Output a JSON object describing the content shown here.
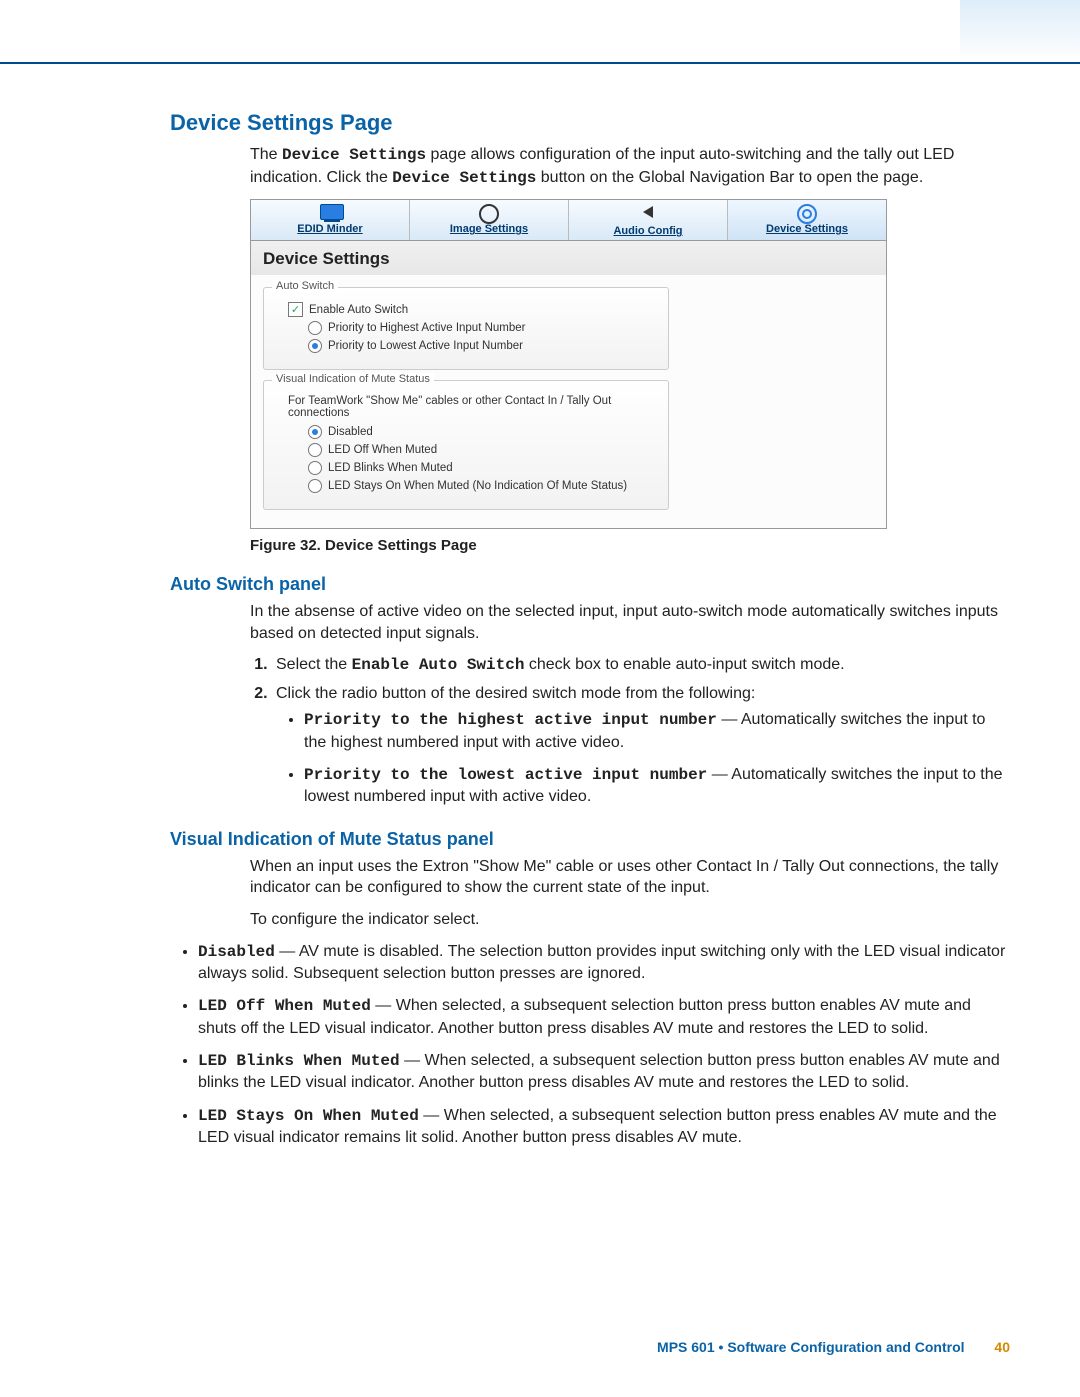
{
  "heading_main": "Device Settings Page",
  "intro_before": "The ",
  "intro_mono1": "Device Settings",
  "intro_mid": " page allows configuration of the input auto-switching and the tally out LED indication. Click the ",
  "intro_mono2": "Device Settings",
  "intro_after": " button on the Global Navigation Bar to open the page.",
  "tabs": {
    "edid": "EDID Minder",
    "image": "Image Settings",
    "audio": "Audio Config",
    "device": "Device Settings"
  },
  "panel": {
    "title": "Device Settings",
    "autoswitch_legend": "Auto Switch",
    "enable_auto": "Enable Auto Switch",
    "prio_high": "Priority to Highest Active Input Number",
    "prio_low": "Priority to Lowest Active Input Number",
    "mute_legend": "Visual Indication of Mute Status",
    "mute_note": "For TeamWork \"Show Me\" cables or other Contact In / Tally Out connections",
    "mute_disabled": "Disabled",
    "mute_off": "LED Off When Muted",
    "mute_blinks": "LED Blinks When Muted",
    "mute_stays": "LED Stays On When Muted (No Indication Of Mute Status)"
  },
  "figure_caption": "Figure 32.   Device Settings Page",
  "heading_autoswitch": "Auto Switch panel",
  "autoswitch_intro": "In the absense of active video on the selected input, input auto-switch mode automatically switches inputs based on detected input signals.",
  "step1_before": "Select the ",
  "step1_mono": "Enable Auto Switch",
  "step1_after": " check box to enable auto-input switch mode.",
  "step2": "Click the radio button of the desired switch mode from the following:",
  "prio_high_mono": "Priority to the highest active input number",
  "prio_high_desc": " — Automatically switches the input to the highest numbered input with active video.",
  "prio_low_mono": "Priority to the lowest active input number",
  "prio_low_desc": " — Automatically switches the input to the lowest numbered input with active video.",
  "heading_mute": "Visual Indication of Mute Status panel",
  "mute_intro": "When an input uses the Extron \"Show Me\" cable or uses other Contact In / Tally Out connections, the tally indicator can be configured to show the current state of the input.",
  "mute_config_lead": "To configure the indicator select.",
  "mute_items": {
    "disabled_mono": "Disabled",
    "disabled_desc": " — AV mute is disabled. The selection button provides input switching only with the LED visual indicator always solid. Subsequent selection button presses are ignored.",
    "off_mono": "LED Off When Muted",
    "off_desc": " — When selected, a subsequent selection button press button enables AV mute and shuts off the LED visual indicator. Another button press disables AV mute and restores the LED to solid.",
    "blinks_mono": "LED Blinks When Muted",
    "blinks_desc": " — When selected, a subsequent selection button press button enables AV mute and blinks the LED visual indicator. Another button press disables AV mute and restores the LED to solid.",
    "stays_mono": "LED Stays On When Muted",
    "stays_desc": " — When selected, a subsequent selection button press enables AV mute and the LED visual indicator remains lit solid. Another button press disables AV mute."
  },
  "footer_text": "MPS 601 • Software Configuration and Control",
  "footer_page": "40"
}
